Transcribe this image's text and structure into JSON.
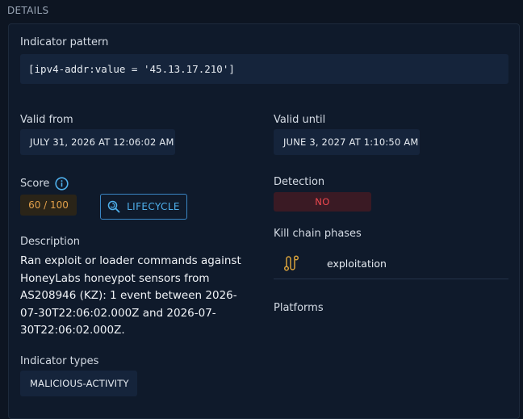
{
  "section": {
    "title": "DETAILS"
  },
  "indicator_pattern": {
    "label": "Indicator pattern",
    "value": "[ipv4-addr:value = '45.13.17.210']"
  },
  "valid_from": {
    "label": "Valid from",
    "value": "JULY 31, 2026 AT 12:06:02 AM"
  },
  "valid_until": {
    "label": "Valid until",
    "value": "JUNE 3, 2027 AT 1:10:50 AM"
  },
  "score": {
    "label": "Score",
    "value": "60 / 100",
    "lifecycle_label": "LIFECYCLE"
  },
  "detection": {
    "label": "Detection",
    "value": "NO"
  },
  "description": {
    "label": "Description",
    "text": "Ran exploit or loader commands against HoneyLabs honeypot sensors from AS208946 (KZ): 1 event between 2026-07-30T22:06:02.000Z and 2026-07-30T22:06:02.000Z."
  },
  "kill_chain": {
    "label": "Kill chain phases",
    "phases": [
      {
        "name": "exploitation",
        "icon": "route-icon"
      }
    ]
  },
  "platforms": {
    "label": "Platforms"
  },
  "indicator_types": {
    "label": "Indicator types",
    "values": [
      "MALICIOUS-ACTIVITY"
    ]
  },
  "colors": {
    "background": "#0d1522",
    "panel": "#0f1a2b",
    "chip": "#15243b",
    "accent": "#4fb0ec",
    "score": "#e2a04a",
    "danger": "#f0484f",
    "killchain_icon": "#d9a23c"
  }
}
